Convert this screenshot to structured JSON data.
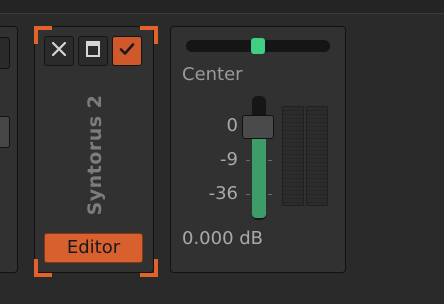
{
  "plugin": {
    "name": "Syntorus 2",
    "editor_label": "Editor",
    "buttons": {
      "close_icon": "close-icon",
      "window_icon": "window-icon",
      "enable_icon": "checkmark-icon"
    }
  },
  "mixer": {
    "pan_label": "Center",
    "pan_value": 0.5,
    "scale_labels": [
      "0",
      "-9",
      "-36"
    ],
    "gain_readout": "0.000 dB",
    "fader_level": 0.72
  },
  "colors": {
    "accent_orange": "#e2622a",
    "pan_knob_green": "#3fcf83",
    "fader_fill_green": "#3e9c6a"
  }
}
